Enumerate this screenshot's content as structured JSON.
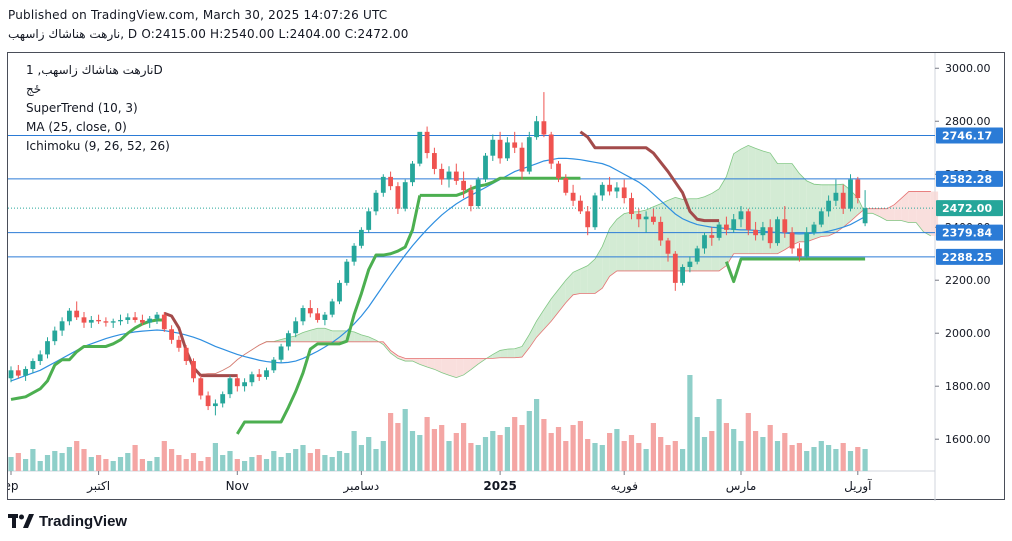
{
  "header": {
    "published": "Published on TradingView.com, March 30, 2025 14:07:26 UTC",
    "ohlc": "نارهت هناشاك زاسهب, D O:2415.00 H:2540.00 L:2404.00 C:2472.00"
  },
  "legend": {
    "symbol": "نارهت هناشاك زاسهب, 1D",
    "exchange": "ځج",
    "supertrend": "SuperTrend (10, 3)",
    "ma": "MA (25, close, 0)",
    "ichimoku": "Ichimoku (9, 26, 52, 26)"
  },
  "brand": {
    "name": "TradingView"
  },
  "colors": {
    "up": "#26a69a",
    "down": "#ef5350",
    "vol_up": "#8fcfc9",
    "vol_down": "#f4a6a4",
    "ma": "#2f8fe0",
    "supertrend_up": "#4caf50",
    "supertrend_down": "#a34b4b",
    "cloud_bull": "#c8e6c9",
    "cloud_bear": "#f8d7d4",
    "level_line": "#2b7bd6",
    "last_price": "#26a69a"
  },
  "chart_data": {
    "type": "candlestick",
    "timeframe": "1D",
    "ylim": [
      1480,
      3050
    ],
    "y_ticks": [
      1600,
      1800,
      2000,
      2200,
      2400,
      2600,
      2800,
      3000
    ],
    "y_tick_labels": [
      "1600.00",
      "1800.00",
      "2000.00",
      "2200.00",
      "2400.00",
      "2600.00",
      "2800.00",
      "3000.00"
    ],
    "x_labels": [
      {
        "text": "ep",
        "bar": 0
      },
      {
        "text": "اكتبر",
        "bar": 12
      },
      {
        "text": "Nov",
        "bar": 31
      },
      {
        "text": "دسامبر",
        "bar": 48
      },
      {
        "text": "2025",
        "bar": 67
      },
      {
        "text": "فوريه",
        "bar": 84
      },
      {
        "text": "مارس",
        "bar": 100
      },
      {
        "text": "آوريل",
        "bar": 116
      }
    ],
    "horizontal_levels": [
      {
        "value": 2746.17,
        "label": "2746.17"
      },
      {
        "value": 2582.28,
        "label": "2582.28"
      },
      {
        "value": 2379.84,
        "label": "2379.84"
      },
      {
        "value": 2288.25,
        "label": "2288.25"
      }
    ],
    "last_price": {
      "value": 2472.0,
      "label": "2472.00"
    },
    "candles": [
      {
        "o": 1830,
        "h": 1875,
        "l": 1815,
        "c": 1860
      },
      {
        "o": 1860,
        "h": 1880,
        "l": 1830,
        "c": 1840
      },
      {
        "o": 1840,
        "h": 1875,
        "l": 1820,
        "c": 1865
      },
      {
        "o": 1865,
        "h": 1905,
        "l": 1850,
        "c": 1895
      },
      {
        "o": 1895,
        "h": 1935,
        "l": 1880,
        "c": 1920
      },
      {
        "o": 1920,
        "h": 1985,
        "l": 1905,
        "c": 1970
      },
      {
        "o": 1970,
        "h": 2025,
        "l": 1955,
        "c": 2010
      },
      {
        "o": 2010,
        "h": 2060,
        "l": 1990,
        "c": 2045
      },
      {
        "o": 2045,
        "h": 2095,
        "l": 2030,
        "c": 2085
      },
      {
        "o": 2085,
        "h": 2120,
        "l": 2050,
        "c": 2060
      },
      {
        "o": 2060,
        "h": 2080,
        "l": 2020,
        "c": 2040
      },
      {
        "o": 2040,
        "h": 2065,
        "l": 2020,
        "c": 2050
      },
      {
        "o": 2050,
        "h": 2070,
        "l": 2035,
        "c": 2045
      },
      {
        "o": 2045,
        "h": 2060,
        "l": 2025,
        "c": 2040
      },
      {
        "o": 2040,
        "h": 2055,
        "l": 2020,
        "c": 2045
      },
      {
        "o": 2045,
        "h": 2070,
        "l": 2030,
        "c": 2050
      },
      {
        "o": 2050,
        "h": 2075,
        "l": 2035,
        "c": 2060
      },
      {
        "o": 2060,
        "h": 2080,
        "l": 2040,
        "c": 2050
      },
      {
        "o": 2050,
        "h": 2070,
        "l": 2030,
        "c": 2040
      },
      {
        "o": 2040,
        "h": 2065,
        "l": 2020,
        "c": 2055
      },
      {
        "o": 2055,
        "h": 2080,
        "l": 2035,
        "c": 2070
      },
      {
        "o": 2070,
        "h": 2080,
        "l": 2005,
        "c": 2015
      },
      {
        "o": 2015,
        "h": 2030,
        "l": 1960,
        "c": 1975
      },
      {
        "o": 1975,
        "h": 1990,
        "l": 1930,
        "c": 1945
      },
      {
        "o": 1945,
        "h": 1955,
        "l": 1880,
        "c": 1895
      },
      {
        "o": 1895,
        "h": 1905,
        "l": 1815,
        "c": 1830
      },
      {
        "o": 1830,
        "h": 1840,
        "l": 1750,
        "c": 1765
      },
      {
        "o": 1765,
        "h": 1780,
        "l": 1710,
        "c": 1725
      },
      {
        "o": 1725,
        "h": 1750,
        "l": 1690,
        "c": 1735
      },
      {
        "o": 1735,
        "h": 1780,
        "l": 1720,
        "c": 1770
      },
      {
        "o": 1770,
        "h": 1840,
        "l": 1755,
        "c": 1830
      },
      {
        "o": 1830,
        "h": 1845,
        "l": 1780,
        "c": 1800
      },
      {
        "o": 1800,
        "h": 1830,
        "l": 1780,
        "c": 1815
      },
      {
        "o": 1815,
        "h": 1855,
        "l": 1800,
        "c": 1845
      },
      {
        "o": 1845,
        "h": 1865,
        "l": 1820,
        "c": 1835
      },
      {
        "o": 1835,
        "h": 1870,
        "l": 1825,
        "c": 1860
      },
      {
        "o": 1860,
        "h": 1910,
        "l": 1850,
        "c": 1900
      },
      {
        "o": 1900,
        "h": 1960,
        "l": 1890,
        "c": 1950
      },
      {
        "o": 1950,
        "h": 2010,
        "l": 1935,
        "c": 2000
      },
      {
        "o": 2000,
        "h": 2060,
        "l": 1985,
        "c": 2045
      },
      {
        "o": 2045,
        "h": 2105,
        "l": 2030,
        "c": 2095
      },
      {
        "o": 2095,
        "h": 2125,
        "l": 2060,
        "c": 2075
      },
      {
        "o": 2075,
        "h": 2095,
        "l": 2040,
        "c": 2050
      },
      {
        "o": 2050,
        "h": 2080,
        "l": 2030,
        "c": 2070
      },
      {
        "o": 2070,
        "h": 2130,
        "l": 2060,
        "c": 2120
      },
      {
        "o": 2120,
        "h": 2200,
        "l": 2110,
        "c": 2190
      },
      {
        "o": 2190,
        "h": 2280,
        "l": 2180,
        "c": 2270
      },
      {
        "o": 2270,
        "h": 2340,
        "l": 2255,
        "c": 2330
      },
      {
        "o": 2330,
        "h": 2400,
        "l": 2320,
        "c": 2390
      },
      {
        "o": 2390,
        "h": 2470,
        "l": 2380,
        "c": 2460
      },
      {
        "o": 2460,
        "h": 2540,
        "l": 2445,
        "c": 2530
      },
      {
        "o": 2530,
        "h": 2600,
        "l": 2515,
        "c": 2590
      },
      {
        "o": 2590,
        "h": 2610,
        "l": 2540,
        "c": 2555
      },
      {
        "o": 2555,
        "h": 2570,
        "l": 2450,
        "c": 2470
      },
      {
        "o": 2470,
        "h": 2580,
        "l": 2460,
        "c": 2570
      },
      {
        "o": 2570,
        "h": 2650,
        "l": 2555,
        "c": 2640
      },
      {
        "o": 2640,
        "h": 2740,
        "l": 2630,
        "c": 2760
      },
      {
        "o": 2760,
        "h": 2780,
        "l": 2660,
        "c": 2680
      },
      {
        "o": 2680,
        "h": 2700,
        "l": 2600,
        "c": 2620
      },
      {
        "o": 2620,
        "h": 2640,
        "l": 2560,
        "c": 2580
      },
      {
        "o": 2580,
        "h": 2630,
        "l": 2550,
        "c": 2610
      },
      {
        "o": 2610,
        "h": 2640,
        "l": 2560,
        "c": 2575
      },
      {
        "o": 2575,
        "h": 2610,
        "l": 2510,
        "c": 2540
      },
      {
        "o": 2540,
        "h": 2560,
        "l": 2460,
        "c": 2480
      },
      {
        "o": 2480,
        "h": 2590,
        "l": 2470,
        "c": 2580
      },
      {
        "o": 2580,
        "h": 2680,
        "l": 2570,
        "c": 2670
      },
      {
        "o": 2670,
        "h": 2750,
        "l": 2650,
        "c": 2730
      },
      {
        "o": 2730,
        "h": 2760,
        "l": 2640,
        "c": 2660
      },
      {
        "o": 2660,
        "h": 2740,
        "l": 2650,
        "c": 2720
      },
      {
        "o": 2720,
        "h": 2760,
        "l": 2680,
        "c": 2700
      },
      {
        "o": 2700,
        "h": 2720,
        "l": 2580,
        "c": 2610
      },
      {
        "o": 2610,
        "h": 2760,
        "l": 2600,
        "c": 2740
      },
      {
        "o": 2740,
        "h": 2820,
        "l": 2730,
        "c": 2800
      },
      {
        "o": 2800,
        "h": 2910,
        "l": 2740,
        "c": 2750
      },
      {
        "o": 2750,
        "h": 2760,
        "l": 2620,
        "c": 2640
      },
      {
        "o": 2640,
        "h": 2650,
        "l": 2570,
        "c": 2585
      },
      {
        "o": 2585,
        "h": 2600,
        "l": 2520,
        "c": 2530
      },
      {
        "o": 2530,
        "h": 2560,
        "l": 2480,
        "c": 2500
      },
      {
        "o": 2500,
        "h": 2520,
        "l": 2450,
        "c": 2460
      },
      {
        "o": 2460,
        "h": 2480,
        "l": 2370,
        "c": 2400
      },
      {
        "o": 2400,
        "h": 2530,
        "l": 2390,
        "c": 2520
      },
      {
        "o": 2520,
        "h": 2570,
        "l": 2500,
        "c": 2560
      },
      {
        "o": 2560,
        "h": 2590,
        "l": 2520,
        "c": 2535
      },
      {
        "o": 2535,
        "h": 2570,
        "l": 2510,
        "c": 2550
      },
      {
        "o": 2550,
        "h": 2580,
        "l": 2490,
        "c": 2510
      },
      {
        "o": 2510,
        "h": 2530,
        "l": 2430,
        "c": 2450
      },
      {
        "o": 2450,
        "h": 2470,
        "l": 2400,
        "c": 2430
      },
      {
        "o": 2430,
        "h": 2460,
        "l": 2380,
        "c": 2440
      },
      {
        "o": 2440,
        "h": 2470,
        "l": 2410,
        "c": 2420
      },
      {
        "o": 2420,
        "h": 2440,
        "l": 2330,
        "c": 2350
      },
      {
        "o": 2350,
        "h": 2360,
        "l": 2270,
        "c": 2300
      },
      {
        "o": 2300,
        "h": 2310,
        "l": 2160,
        "c": 2190
      },
      {
        "o": 2190,
        "h": 2260,
        "l": 2180,
        "c": 2250
      },
      {
        "o": 2250,
        "h": 2290,
        "l": 2230,
        "c": 2270
      },
      {
        "o": 2270,
        "h": 2330,
        "l": 2260,
        "c": 2320
      },
      {
        "o": 2320,
        "h": 2380,
        "l": 2300,
        "c": 2370
      },
      {
        "o": 2370,
        "h": 2400,
        "l": 2330,
        "c": 2360
      },
      {
        "o": 2360,
        "h": 2420,
        "l": 2350,
        "c": 2410
      },
      {
        "o": 2410,
        "h": 2440,
        "l": 2370,
        "c": 2390
      },
      {
        "o": 2390,
        "h": 2450,
        "l": 2380,
        "c": 2430
      },
      {
        "o": 2430,
        "h": 2480,
        "l": 2400,
        "c": 2460
      },
      {
        "o": 2460,
        "h": 2470,
        "l": 2370,
        "c": 2390
      },
      {
        "o": 2390,
        "h": 2420,
        "l": 2350,
        "c": 2370
      },
      {
        "o": 2370,
        "h": 2420,
        "l": 2350,
        "c": 2400
      },
      {
        "o": 2400,
        "h": 2430,
        "l": 2320,
        "c": 2340
      },
      {
        "o": 2340,
        "h": 2440,
        "l": 2330,
        "c": 2430
      },
      {
        "o": 2430,
        "h": 2480,
        "l": 2360,
        "c": 2380
      },
      {
        "o": 2380,
        "h": 2400,
        "l": 2300,
        "c": 2320
      },
      {
        "o": 2320,
        "h": 2340,
        "l": 2270,
        "c": 2290
      },
      {
        "o": 2290,
        "h": 2400,
        "l": 2280,
        "c": 2380
      },
      {
        "o": 2380,
        "h": 2420,
        "l": 2370,
        "c": 2410
      },
      {
        "o": 2410,
        "h": 2470,
        "l": 2400,
        "c": 2460
      },
      {
        "o": 2460,
        "h": 2520,
        "l": 2440,
        "c": 2500
      },
      {
        "o": 2500,
        "h": 2580,
        "l": 2480,
        "c": 2530
      },
      {
        "o": 2530,
        "h": 2560,
        "l": 2450,
        "c": 2470
      },
      {
        "o": 2470,
        "h": 2600,
        "l": 2460,
        "c": 2580
      },
      {
        "o": 2580,
        "h": 2590,
        "l": 2490,
        "c": 2510
      },
      {
        "o": 2415,
        "h": 2540,
        "l": 2404,
        "c": 2472
      }
    ],
    "volume_scale_max": 100,
    "volumes": [
      14,
      18,
      12,
      22,
      10,
      16,
      20,
      18,
      24,
      30,
      22,
      14,
      16,
      12,
      10,
      14,
      18,
      26,
      12,
      10,
      14,
      30,
      22,
      16,
      12,
      18,
      10,
      14,
      28,
      16,
      20,
      12,
      10,
      14,
      16,
      12,
      20,
      14,
      18,
      22,
      26,
      18,
      22,
      16,
      14,
      20,
      18,
      40,
      26,
      34,
      22,
      30,
      58,
      48,
      62,
      40,
      36,
      54,
      42,
      46,
      30,
      38,
      48,
      28,
      26,
      34,
      40,
      36,
      44,
      54,
      46,
      60,
      72,
      52,
      38,
      44,
      30,
      46,
      50,
      32,
      28,
      26,
      38,
      42,
      30,
      36,
      28,
      22,
      48,
      34,
      26,
      30,
      22,
      96,
      54,
      34,
      40,
      72,
      48,
      42,
      30,
      58,
      40,
      34,
      46,
      30,
      38,
      26,
      28,
      20,
      24,
      30,
      26,
      22,
      28,
      20,
      24,
      22
    ],
    "supertrend": [
      {
        "from": 0,
        "to": 22,
        "dir": "up",
        "values": [
          1750,
          1755,
          1760,
          1775,
          1790,
          1820,
          1880,
          1900,
          1900,
          1930,
          1950,
          1950,
          1950,
          1950,
          1960,
          1975,
          2000,
          2020,
          2035,
          2045,
          2050,
          2050
        ]
      },
      {
        "from": 21,
        "to": 26,
        "dir": "down",
        "values": [
          2075,
          2065,
          2020,
          1935,
          1870,
          1840
        ]
      },
      {
        "from": 26,
        "to": 31,
        "dir": "down",
        "values": [
          1840,
          1840,
          1840,
          1840,
          1840,
          1840
        ]
      },
      {
        "from": 31,
        "to": 56,
        "dir": "up",
        "values": [
          1620,
          1665,
          1665,
          1665,
          1665,
          1665,
          1665,
          1720,
          1780,
          1850,
          1940,
          1960,
          1960,
          1960,
          1960,
          1970,
          2070,
          2150,
          2240,
          2295,
          2295,
          2300,
          2310,
          2325,
          2390,
          2520
        ]
      },
      {
        "from": 56,
        "to": 78,
        "dir": "up",
        "values": [
          2520,
          2520,
          2520,
          2520,
          2520,
          2520,
          2530,
          2545,
          2555,
          2560,
          2570,
          2585,
          2585,
          2585,
          2585,
          2585,
          2585,
          2585,
          2585,
          2585,
          2585,
          2585,
          2585
        ]
      },
      {
        "from": 78,
        "to": 98,
        "dir": "down",
        "values": [
          2760,
          2740,
          2700,
          2700,
          2700,
          2700,
          2700,
          2700,
          2700,
          2700,
          2680,
          2645,
          2610,
          2570,
          2530,
          2460,
          2430,
          2425,
          2425,
          2425
        ]
      },
      {
        "from": 98,
        "to": 117,
        "dir": "up",
        "values": [
          2270,
          2195,
          2280,
          2280,
          2280,
          2280,
          2280,
          2280,
          2280,
          2280,
          2280,
          2280,
          2280,
          2280,
          2280,
          2280,
          2280,
          2280,
          2280,
          2280
        ]
      }
    ],
    "ma": [
      1820,
      1830,
      1840,
      1850,
      1860,
      1875,
      1890,
      1905,
      1920,
      1935,
      1950,
      1960,
      1970,
      1980,
      1988,
      1995,
      2000,
      2005,
      2008,
      2010,
      2012,
      2010,
      2005,
      2000,
      1993,
      1985,
      1975,
      1963,
      1950,
      1940,
      1930,
      1920,
      1912,
      1905,
      1898,
      1893,
      1890,
      1888,
      1890,
      1895,
      1905,
      1918,
      1932,
      1948,
      1965,
      1985,
      2008,
      2035,
      2065,
      2100,
      2140,
      2180,
      2220,
      2258,
      2295,
      2330,
      2362,
      2392,
      2420,
      2446,
      2468,
      2488,
      2505,
      2520,
      2535,
      2550,
      2565,
      2580,
      2595,
      2610,
      2620,
      2630,
      2640,
      2650,
      2655,
      2660,
      2660,
      2658,
      2655,
      2650,
      2645,
      2640,
      2630,
      2615,
      2600,
      2585,
      2570,
      2550,
      2525,
      2500,
      2475,
      2450,
      2432,
      2420,
      2410,
      2405,
      2400,
      2398,
      2395,
      2392,
      2390,
      2390,
      2388,
      2385,
      2382,
      2380,
      2378,
      2376,
      2375,
      2376,
      2378,
      2380,
      2385,
      2392,
      2400,
      2410,
      2425,
      2440
    ],
    "ichimoku_cloud_offset_bars": 26
  }
}
